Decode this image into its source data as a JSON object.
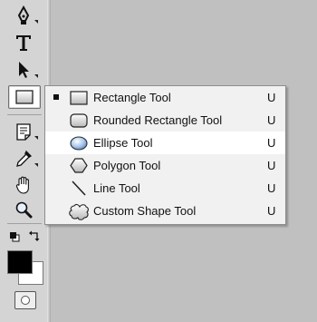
{
  "toolbar": {
    "tools": [
      {
        "name": "pen-tool",
        "icon": "pen-nib-icon"
      },
      {
        "name": "type-tool",
        "icon": "text-T-icon"
      },
      {
        "name": "path-selection-tool",
        "icon": "arrow-cursor-icon"
      },
      {
        "name": "rectangle-tool",
        "icon": "rectangle-icon",
        "active": true
      },
      {
        "name": "notes-tool",
        "icon": "notes-icon"
      },
      {
        "name": "eyedropper-tool",
        "icon": "eyedropper-icon"
      },
      {
        "name": "hand-tool",
        "icon": "hand-icon"
      },
      {
        "name": "zoom-tool",
        "icon": "magnifier-icon"
      }
    ],
    "colors": {
      "foreground": "#000000",
      "background": "#ffffff"
    }
  },
  "menu": {
    "items": [
      {
        "label": "Rectangle Tool",
        "shortcut": "U",
        "icon": "rectangle-shape-icon",
        "selected": true
      },
      {
        "label": "Rounded Rectangle Tool",
        "shortcut": "U",
        "icon": "rounded-rectangle-shape-icon"
      },
      {
        "label": "Ellipse Tool",
        "shortcut": "U",
        "icon": "ellipse-shape-icon",
        "highlighted": true
      },
      {
        "label": "Polygon Tool",
        "shortcut": "U",
        "icon": "polygon-shape-icon"
      },
      {
        "label": "Line Tool",
        "shortcut": "U",
        "icon": "line-shape-icon"
      },
      {
        "label": "Custom Shape Tool",
        "shortcut": "U",
        "icon": "custom-shape-icon"
      }
    ]
  }
}
